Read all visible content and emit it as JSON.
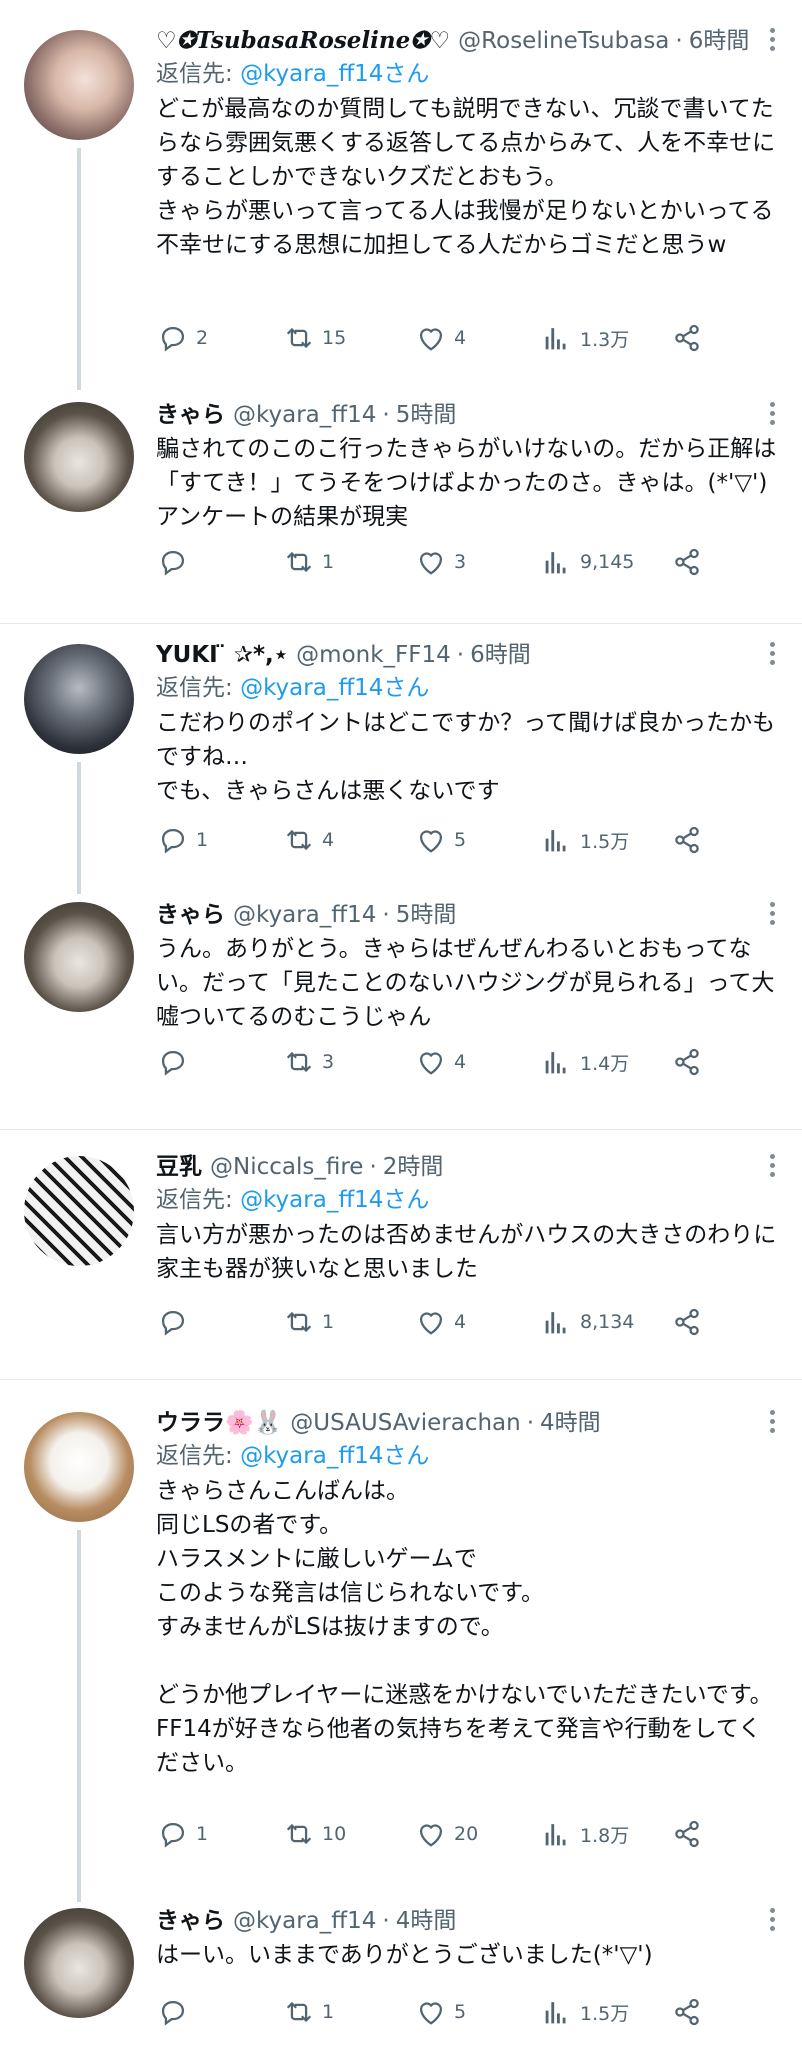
{
  "tweets": [
    {
      "name": "♡✪TsubasaRoseline✪♡",
      "handle": "@RoselineTsubasa",
      "time": "6時間",
      "reply_prefix": "返信先: ",
      "reply_to": "@kyara_ff14さん",
      "text": "どこが最高なのか質問しても説明できない、冗談で書いてたらなら雰囲気悪くする返答してる点からみて、人を不幸せにすることしかできないクズだとおもう。\nきゃらが悪いって言ってる人は我慢が足りないとかいってる不幸せにする思想に加担してる人だからゴミだと思うw",
      "replies": "2",
      "retweets": "15",
      "likes": "4",
      "views": "1.3万"
    },
    {
      "name": "きゃら",
      "handle": "@kyara_ff14",
      "time": "5時間",
      "text": "騙されてのこのこ行ったきゃらがいけないの。だから正解は「すてき！」てうそをつけばよかったのさ。きゃは。(*'▽')アンケートの結果が現実",
      "replies": "",
      "retweets": "1",
      "likes": "3",
      "views": "9,145"
    },
    {
      "name": "YUKI ̈ ✰*,⋆",
      "handle": "@monk_FF14",
      "time": "6時間",
      "reply_prefix": "返信先: ",
      "reply_to": "@kyara_ff14さん",
      "text": "こだわりのポイントはどこですか？って聞けば良かったかもですね…\nでも、きゃらさんは悪くないです",
      "replies": "1",
      "retweets": "4",
      "likes": "5",
      "views": "1.5万"
    },
    {
      "name": "きゃら",
      "handle": "@kyara_ff14",
      "time": "5時間",
      "text": "うん。ありがとう。きゃらはぜんぜんわるいとおもってない。だって「見たことのないハウジングが見られる」って大嘘ついてるのむこうじゃん",
      "replies": "",
      "retweets": "3",
      "likes": "4",
      "views": "1.4万"
    },
    {
      "name": "豆乳",
      "handle": "@Niccals_fire",
      "time": "2時間",
      "reply_prefix": "返信先: ",
      "reply_to": "@kyara_ff14さん",
      "text": "言い方が悪かったのは否めませんがハウスの大きさのわりに家主も器が狭いなと思いました",
      "replies": "",
      "retweets": "1",
      "likes": "4",
      "views": "8,134"
    },
    {
      "name": "ウララ🌸🐰",
      "handle": "@USAUSAvierachan",
      "time": "4時間",
      "reply_prefix": "返信先: ",
      "reply_to": "@kyara_ff14さん",
      "text": "きゃらさんこんばんは。\n同じLSの者です。\nハラスメントに厳しいゲームで\nこのような発言は信じられないです。\nすみませんがLSは抜けますので。\n\nどうか他プレイヤーに迷惑をかけないでいただきたいです。\nFF14が好きなら他者の気持ちを考えて発言や行動をしてください。",
      "replies": "1",
      "retweets": "10",
      "likes": "20",
      "views": "1.8万"
    },
    {
      "name": "きゃら",
      "handle": "@kyara_ff14",
      "time": "4時間",
      "text": "はーい。いままでありがとうございました(*'▽')",
      "replies": "",
      "retweets": "1",
      "likes": "5",
      "views": "1.5万"
    }
  ],
  "colors": {
    "link": "#1d9bf0",
    "secondary": "#536471",
    "thread_line": "#cfd9de"
  },
  "icons": {
    "reply": "reply-icon",
    "retweet": "retweet-icon",
    "like": "heart-icon",
    "views": "views-icon",
    "share": "share-icon",
    "more": "more-icon"
  }
}
